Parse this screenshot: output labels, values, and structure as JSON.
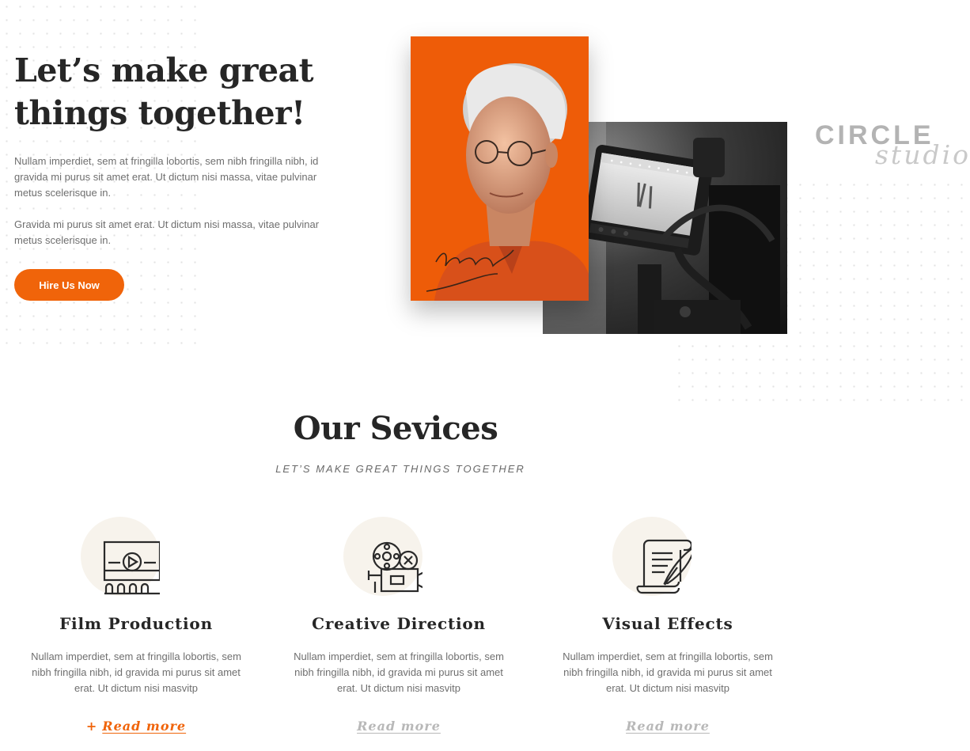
{
  "hero": {
    "title": "Let’s make great things together!",
    "paragraph_1": "Nullam imperdiet, sem at fringilla lobortis, sem nibh fringilla nibh, id gravida mi purus sit amet erat. Ut dictum nisi massa, vitae pulvinar metus scelerisque in.",
    "paragraph_2": "Gravida mi purus sit amet erat. Ut dictum nisi massa, vitae pulvinar metus scelerisque in.",
    "cta_label": "Hire Us Now"
  },
  "brand": {
    "word_1": "CIRCLE",
    "word_2": "studio"
  },
  "services": {
    "title": "Our Sevices",
    "subtitle": "LET’S MAKE GREAT THINGS TOGETHER",
    "items": [
      {
        "icon": "film-screen-icon",
        "title": "Film Production",
        "text": "Nullam imperdiet, sem at fringilla lobortis, sem nibh fringilla nibh, id gravida mi purus sit amet erat. Ut dictum nisi masvitp",
        "link_label": "Read more",
        "link_prefix": "+"
      },
      {
        "icon": "film-projector-icon",
        "title": "Creative Direction",
        "text": "Nullam imperdiet, sem at fringilla lobortis, sem nibh fringilla nibh, id gravida mi purus sit amet erat. Ut dictum nisi masvitp",
        "link_label": "Read more"
      },
      {
        "icon": "script-quill-icon",
        "title": "Visual Effects",
        "text": "Nullam imperdiet, sem at fringilla lobortis, sem nibh fringilla nibh, id gravida mi purus sit amet erat. Ut dictum nisi masvitp",
        "link_label": "Read more"
      }
    ]
  },
  "colors": {
    "accent": "#f0640a",
    "text_dark": "#262626",
    "text_muted": "#6f6f6f",
    "icon_circle": "#f7f3ec"
  }
}
